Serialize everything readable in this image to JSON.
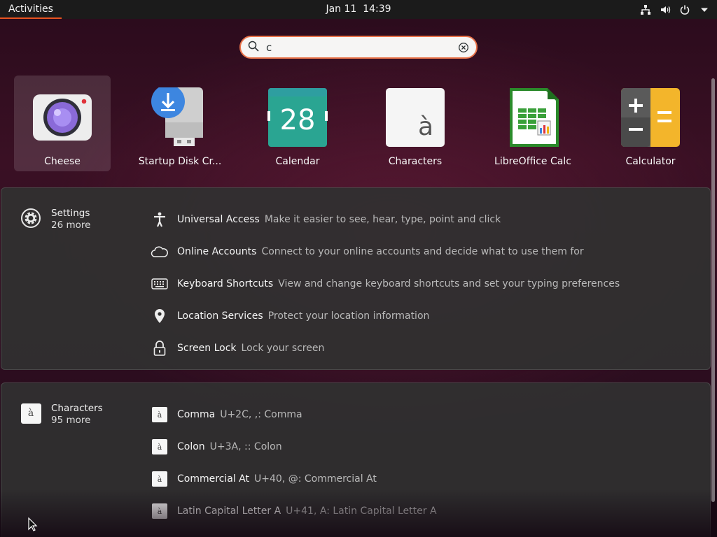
{
  "topbar": {
    "activities": "Activities",
    "date": "Jan 11",
    "time": "14:39",
    "tray_icons": [
      "network-icon",
      "volume-icon",
      "power-icon",
      "menu-arrow-icon"
    ]
  },
  "search": {
    "value": "c"
  },
  "apps": [
    {
      "label": "Cheese",
      "icon": "cheese-icon",
      "selected": true
    },
    {
      "label": "Startup Disk Cr...",
      "icon": "startup-disk-icon"
    },
    {
      "label": "Calendar",
      "icon": "calendar-icon",
      "day": "28"
    },
    {
      "label": "Characters",
      "icon": "characters-icon",
      "glyph": "à"
    },
    {
      "label": "LibreOffice Calc",
      "icon": "libreoffice-calc-icon"
    },
    {
      "label": "Calculator",
      "icon": "calculator-icon"
    }
  ],
  "settings": {
    "provider": "Settings",
    "more": "26 more",
    "results": [
      {
        "title": "Universal Access",
        "desc": "Make it easier to see, hear, type, point and click",
        "icon": "accessibility-icon"
      },
      {
        "title": "Online Accounts",
        "desc": "Connect to your online accounts and decide what to use them for",
        "icon": "cloud-icon"
      },
      {
        "title": "Keyboard Shortcuts",
        "desc": "View and change keyboard shortcuts and set your typing preferences",
        "icon": "keyboard-icon"
      },
      {
        "title": "Location Services",
        "desc": "Protect your location information",
        "icon": "location-pin-icon"
      },
      {
        "title": "Screen Lock",
        "desc": "Lock your screen",
        "icon": "lock-icon"
      }
    ]
  },
  "characters": {
    "provider": "Characters",
    "more": "95 more",
    "glyph": "à",
    "results": [
      {
        "title": "Comma",
        "desc": "U+2C, ,: Comma"
      },
      {
        "title": "Colon",
        "desc": "U+3A, :: Colon"
      },
      {
        "title": "Commercial At",
        "desc": "U+40, @: Commercial At"
      },
      {
        "title": "Latin Capital Letter A",
        "desc": "U+41, A: Latin Capital Letter A"
      }
    ]
  },
  "colors": {
    "accent": "#e95420",
    "panel": "#303030",
    "topbar": "#1b1b1b"
  }
}
